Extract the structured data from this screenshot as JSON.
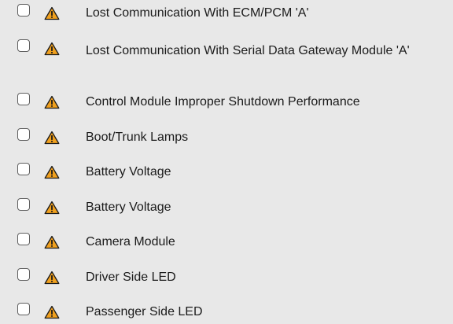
{
  "colors": {
    "background": "#e8e8e8",
    "warning_fill": "#f0a01e",
    "warning_stroke": "#1a1a1a",
    "checkbox_border": "#5f5f5f",
    "text": "#1b1b1b"
  },
  "items": [
    {
      "label": "Lost Communication With ECM/PCM 'A'",
      "checked": false,
      "icon": "warning-icon"
    },
    {
      "label": "Lost Communication With Serial Data Gateway Module 'A'",
      "checked": false,
      "icon": "warning-icon"
    },
    {
      "label": "Control Module Improper Shutdown Performance",
      "checked": false,
      "icon": "warning-icon"
    },
    {
      "label": "Boot/Trunk Lamps",
      "checked": false,
      "icon": "warning-icon"
    },
    {
      "label": "Battery Voltage",
      "checked": false,
      "icon": "warning-icon"
    },
    {
      "label": "Battery Voltage",
      "checked": false,
      "icon": "warning-icon"
    },
    {
      "label": "Camera Module",
      "checked": false,
      "icon": "warning-icon"
    },
    {
      "label": "Driver Side LED",
      "checked": false,
      "icon": "warning-icon"
    },
    {
      "label": "Passenger Side LED",
      "checked": false,
      "icon": "warning-icon"
    }
  ]
}
